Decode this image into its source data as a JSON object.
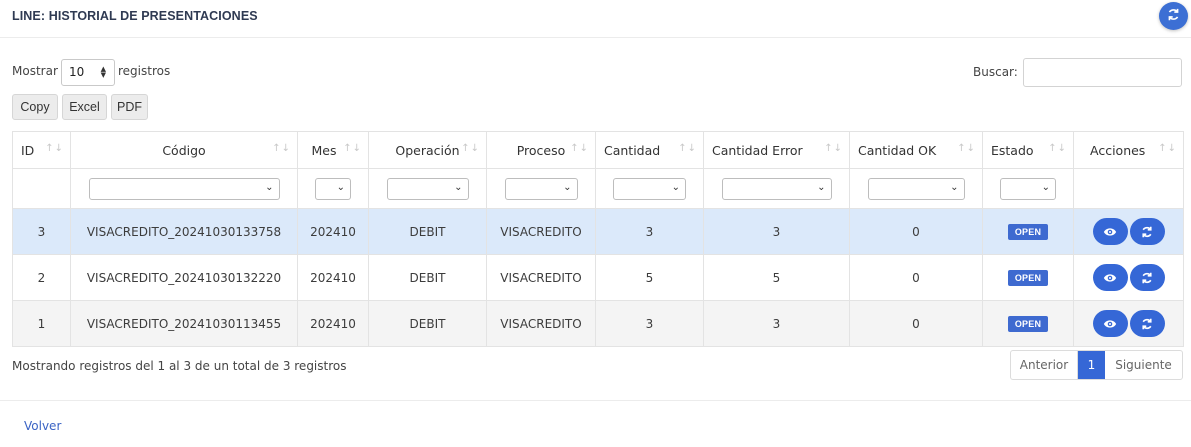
{
  "header": {
    "title": "LINE: HISTORIAL DE PRESENTACIONES",
    "refresh_icon": "refresh-icon"
  },
  "controls": {
    "show_label": "Mostrar",
    "page_length": "10",
    "records_label": "registros",
    "search_label": "Buscar:",
    "search_value": ""
  },
  "export_buttons": [
    "Copy",
    "Excel",
    "PDF"
  ],
  "table": {
    "columns": [
      "ID",
      "Código",
      "Mes",
      "Operación",
      "Proceso",
      "Cantidad",
      "Cantidad Error",
      "Cantidad OK",
      "Estado",
      "Acciones"
    ],
    "rows": [
      {
        "id": "3",
        "codigo": "VISACREDITO_20241030133758",
        "mes": "202410",
        "operacion": "DEBIT",
        "proceso": "VISACREDITO",
        "cantidad": "3",
        "cantidad_error": "3",
        "cantidad_ok": "0",
        "estado": "OPEN",
        "selected": true
      },
      {
        "id": "2",
        "codigo": "VISACREDITO_20241030132220",
        "mes": "202410",
        "operacion": "DEBIT",
        "proceso": "VISACREDITO",
        "cantidad": "5",
        "cantidad_error": "5",
        "cantidad_ok": "0",
        "estado": "OPEN",
        "selected": false
      },
      {
        "id": "1",
        "codigo": "VISACREDITO_20241030113455",
        "mes": "202410",
        "operacion": "DEBIT",
        "proceso": "VISACREDITO",
        "cantidad": "3",
        "cantidad_error": "3",
        "cantidad_ok": "0",
        "estado": "OPEN",
        "selected": false
      }
    ],
    "action_icons": [
      "eye-icon",
      "refresh-icon"
    ]
  },
  "footer": {
    "info": "Mostrando registros del 1 al 3 de un total de 3 registros",
    "pager": {
      "previous": "Anterior",
      "current": "1",
      "next": "Siguiente"
    },
    "back_link": "Volver"
  },
  "colors": {
    "accent": "#3567d6",
    "badge": "#3e6ad0",
    "selected_row": "#dbe9fa",
    "striped_row": "#f4f4f4",
    "title": "#2f3a52"
  }
}
